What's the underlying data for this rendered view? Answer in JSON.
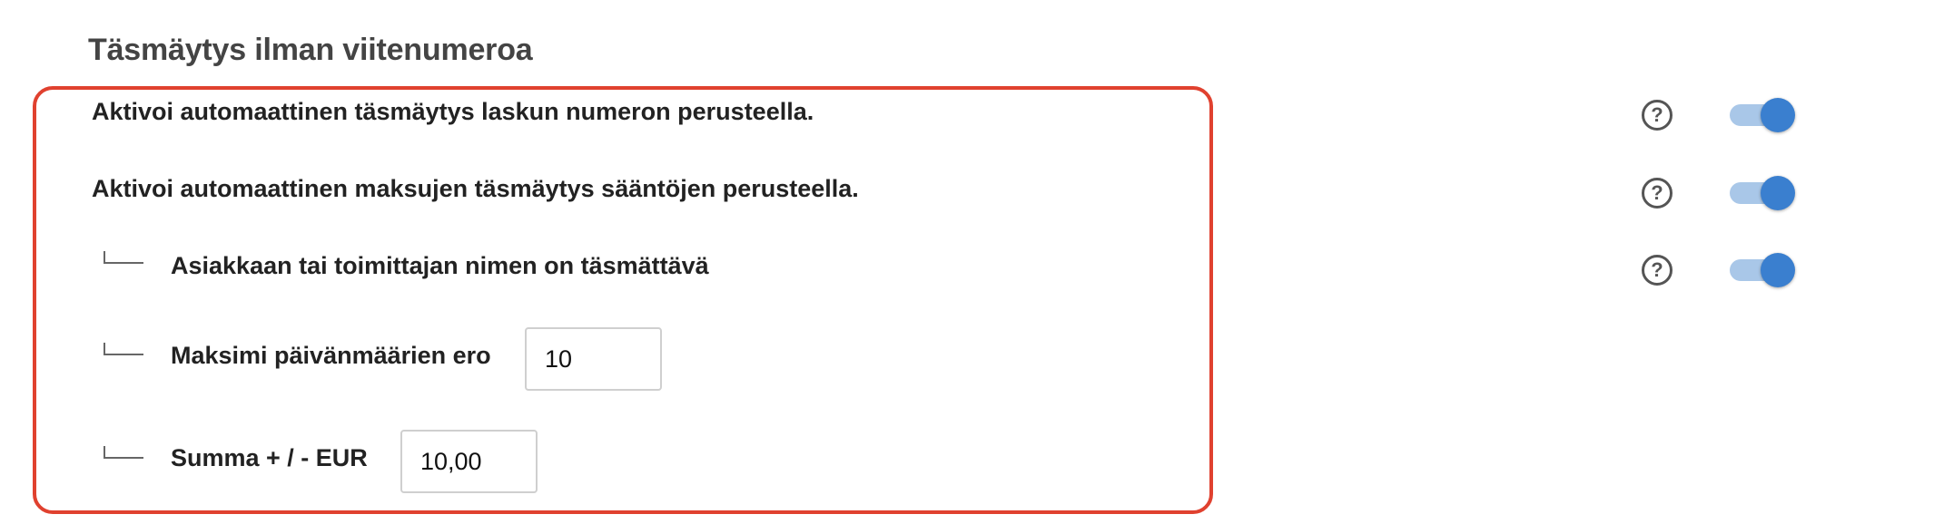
{
  "section": {
    "title": "Täsmäytys ilman viitenumeroa"
  },
  "rows": [
    {
      "label": "Aktivoi automaattinen täsmäytys laskun numeron perusteella.",
      "help_icon": "question-circle-icon",
      "toggle_on": true
    },
    {
      "label": "Aktivoi automaattinen maksujen täsmäytys sääntöjen perusteella.",
      "help_icon": "question-circle-icon",
      "toggle_on": true
    },
    {
      "label": "Asiakkaan tai toimittajan nimen on täsmättävä",
      "help_icon": "question-circle-icon",
      "toggle_on": true
    },
    {
      "label": "Maksimi päivänmäärien ero",
      "input_value": "10"
    },
    {
      "label": "Summa + / - EUR",
      "input_value": "10,00"
    }
  ],
  "help_glyph": "?",
  "colors": {
    "highlight_border": "#e0412f",
    "toggle_thumb": "#3a7fcf",
    "toggle_track": "#a9c7e8",
    "title_text": "#444444"
  }
}
